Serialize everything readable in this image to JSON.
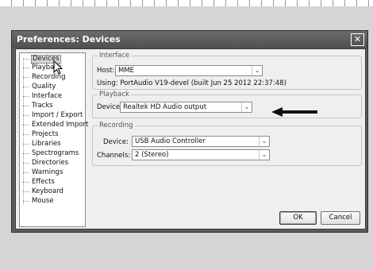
{
  "window": {
    "title": "Preferences: Devices"
  },
  "sidebar": {
    "items": [
      {
        "label": "Devices",
        "selected": true
      },
      {
        "label": "Playback"
      },
      {
        "label": "Recording"
      },
      {
        "label": "Quality"
      },
      {
        "label": "Interface"
      },
      {
        "label": "Tracks"
      },
      {
        "label": "Import / Export"
      },
      {
        "label": "Extended Import"
      },
      {
        "label": "Projects"
      },
      {
        "label": "Libraries"
      },
      {
        "label": "Spectrograms"
      },
      {
        "label": "Directories"
      },
      {
        "label": "Warnings"
      },
      {
        "label": "Effects"
      },
      {
        "label": "Keyboard"
      },
      {
        "label": "Mouse"
      }
    ]
  },
  "interface": {
    "legend": "Interface",
    "host_label": "Host:",
    "host_value": "MME",
    "using_text": "Using: PortAudio V19-devel (built Jun 25 2012 22:37:48)"
  },
  "playback": {
    "legend": "Playback",
    "device_label": "Device:",
    "device_value": "Realtek HD Audio output"
  },
  "recording": {
    "legend": "Recording",
    "device_label": "Device:",
    "device_value": "USB Audio Controller",
    "channels_label": "Channels:",
    "channels_value": "2 (Stereo)"
  },
  "buttons": {
    "ok": "OK",
    "cancel": "Cancel"
  },
  "icons": {
    "close": "close-icon",
    "dropdown": "chevron-down-icon",
    "pointer": "arrow-pointer-icon",
    "annotation": "left-arrow-icon",
    "close_glyph": "✕",
    "dropdown_glyph": "⌄"
  },
  "colors": {
    "titlebar": "#5c5c5c",
    "desktop": "#d5d5d5",
    "arrow": "#111111"
  }
}
